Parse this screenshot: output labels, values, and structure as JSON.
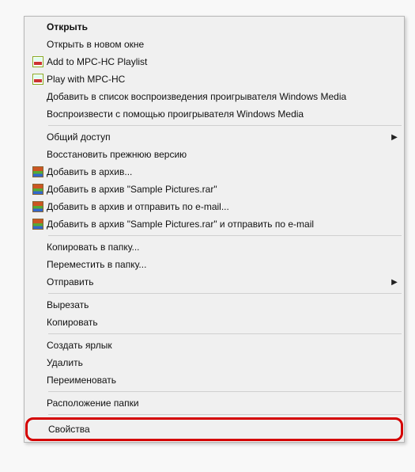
{
  "menu": {
    "open": "Открыть",
    "open_new_window": "Открыть в новом окне",
    "add_mpc": "Add to MPC-HC Playlist",
    "play_mpc": "Play with MPC-HC",
    "wmp_playlist": "Добавить в список воспроизведения проигрывателя Windows Media",
    "wmp_play": "Воспроизвести с помощью проигрывателя Windows Media",
    "share": "Общий доступ",
    "restore_prev": "Восстановить прежнюю версию",
    "add_archive": "Добавить в архив...",
    "add_archive_named": "Добавить в архив \"Sample Pictures.rar\"",
    "add_email": "Добавить в архив и отправить по e-mail...",
    "add_named_email": "Добавить в архив \"Sample Pictures.rar\" и отправить по e-mail",
    "copy_to": "Копировать в папку...",
    "move_to": "Переместить в папку...",
    "send_to": "Отправить",
    "cut": "Вырезать",
    "copy": "Копировать",
    "shortcut": "Создать ярлык",
    "delete": "Удалить",
    "rename": "Переименовать",
    "folder_location": "Расположение папки",
    "properties": "Свойства"
  },
  "arrow": "▶"
}
